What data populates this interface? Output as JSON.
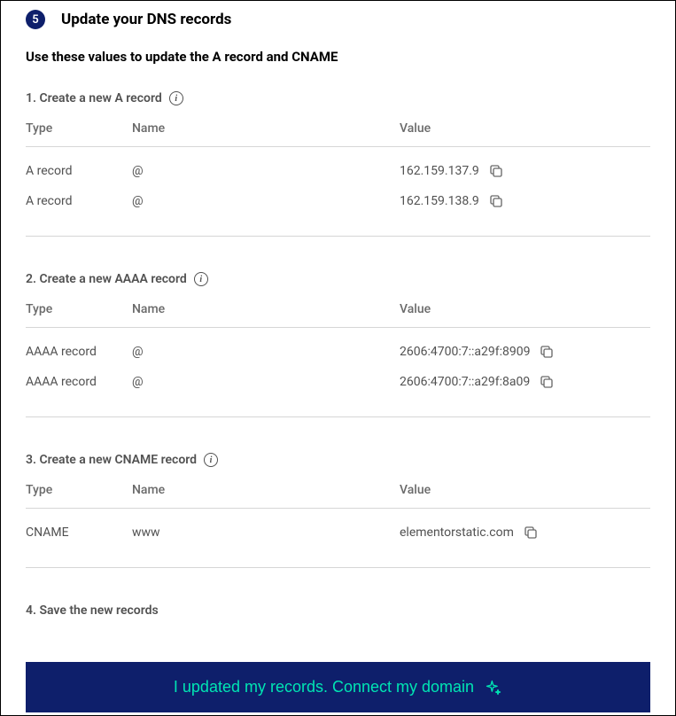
{
  "header": {
    "step_number": "5",
    "title": "Update your DNS records"
  },
  "subtitle": "Use these values to update the A record and CNAME",
  "columns": {
    "type": "Type",
    "name": "Name",
    "value": "Value"
  },
  "sections": [
    {
      "title": "1. Create a new A record",
      "has_info": true,
      "rows": [
        {
          "type": "A record",
          "name": "@",
          "value": "162.159.137.9"
        },
        {
          "type": "A record",
          "name": "@",
          "value": "162.159.138.9"
        }
      ]
    },
    {
      "title": "2. Create a new AAAA record",
      "has_info": true,
      "rows": [
        {
          "type": "AAAA record",
          "name": "@",
          "value": "2606:4700:7::a29f:8909"
        },
        {
          "type": "AAAA record",
          "name": "@",
          "value": "2606:4700:7::a29f:8a09"
        }
      ]
    },
    {
      "title": "3. Create a new CNAME record",
      "has_info": true,
      "rows": [
        {
          "type": "CNAME",
          "name": "www",
          "value": "elementorstatic.com"
        }
      ]
    }
  ],
  "save_title": "4. Save the new records",
  "cta_label": "I updated my records. Connect my domain"
}
